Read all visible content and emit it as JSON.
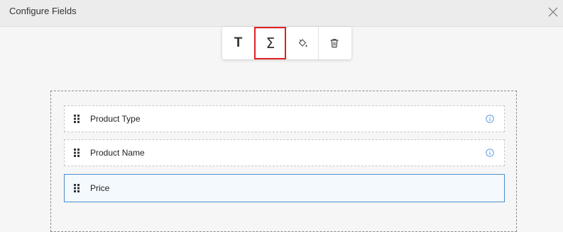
{
  "header": {
    "title": "Configure Fields"
  },
  "toolbar": {
    "text_tool_glyph": "T",
    "sum_tool_glyph": "Σ",
    "selected_tool": "sum",
    "highlight_color": "#e02020"
  },
  "fields": [
    {
      "label": "Product Type",
      "has_info": true
    },
    {
      "label": "Product Name",
      "has_info": true
    },
    {
      "label": "Price",
      "has_info": false,
      "active": true
    }
  ],
  "colors": {
    "info": "#4a90d9",
    "active_border": "#4d8ecb"
  }
}
